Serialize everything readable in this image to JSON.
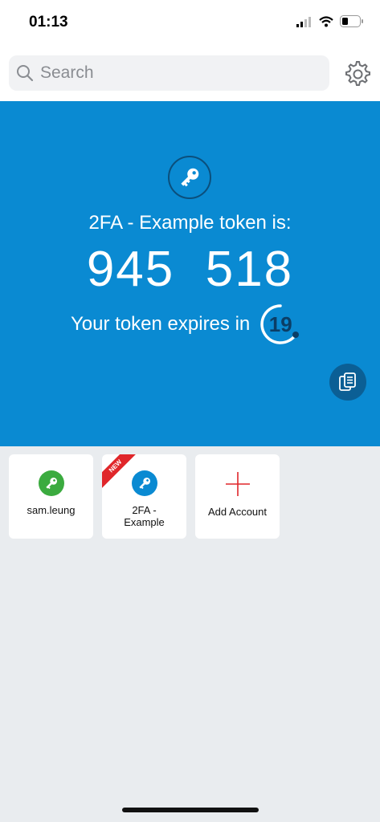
{
  "status": {
    "time": "01:13"
  },
  "search": {
    "placeholder": "Search"
  },
  "hero": {
    "token_label": "2FA - Example token is:",
    "token_value": "945  518",
    "expires_label": "Your token expires in",
    "timer_seconds": "19"
  },
  "accounts": [
    {
      "label": "sam.leung",
      "icon": "key-icon",
      "color": "#3bab3f"
    },
    {
      "label": "2FA -\nExample",
      "icon": "key-icon",
      "color": "#0a8ad2",
      "badge": "NEW"
    }
  ],
  "add_account": {
    "label": "Add Account"
  },
  "colors": {
    "hero": "#0a8ad2",
    "accent_red": "#e0262a"
  }
}
